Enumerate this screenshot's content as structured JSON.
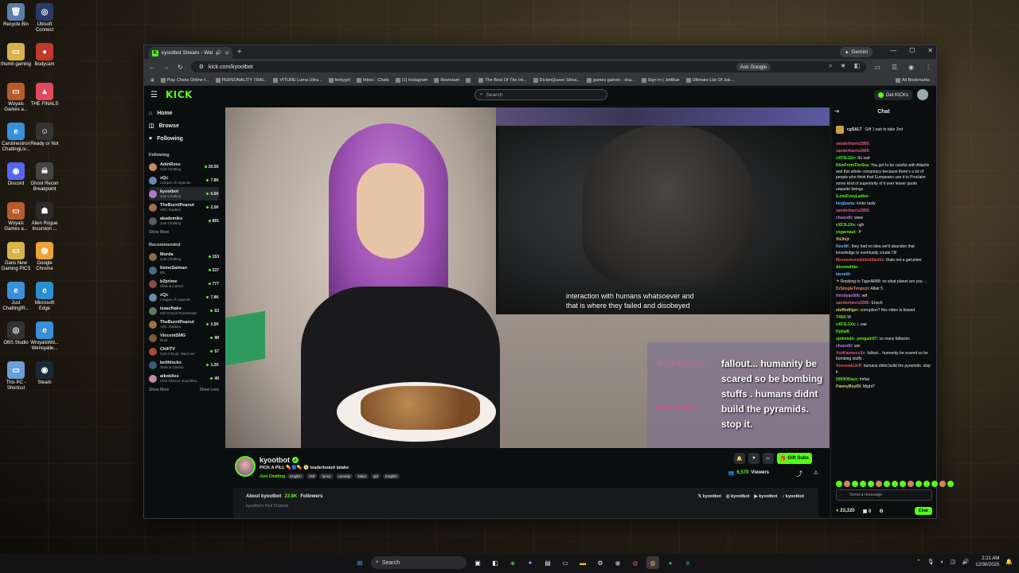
{
  "desktop": {
    "icons": [
      {
        "label": "Recycle Bin",
        "color": "#5b7fa8",
        "glyph": "🗑"
      },
      {
        "label": "Ubisoft Connect",
        "color": "#2a3a6a",
        "glyph": "◎"
      },
      {
        "label": "thumb gaming",
        "color": "#d9b34a",
        "glyph": "▭"
      },
      {
        "label": "Bodycam",
        "color": "#c0392b",
        "glyph": "●"
      },
      {
        "label": "Woyals Games a...",
        "color": "#b85a2a",
        "glyph": "▭"
      },
      {
        "label": "THE FINALS",
        "color": "#e04a60",
        "glyph": "▲"
      },
      {
        "label": "Carolinestron ChattingLiv...",
        "color": "#3a8fd9",
        "glyph": "e"
      },
      {
        "label": "Ready or Not",
        "color": "#333",
        "glyph": "☺"
      },
      {
        "label": "Discord",
        "color": "#5865f2",
        "glyph": "◉"
      },
      {
        "label": "Ghost Recon Breakpoint",
        "color": "#444",
        "glyph": "☠"
      },
      {
        "label": "Woyals Games a...",
        "color": "#b85a2a",
        "glyph": "▭"
      },
      {
        "label": "Alien Rogue Incursion ...",
        "color": "#2b2b2b",
        "glyph": "☗"
      },
      {
        "label": "Dans New Gaming PICS",
        "color": "#d9b34a",
        "glyph": "▭"
      },
      {
        "label": "Google Chrome",
        "color": "#e8a33a",
        "glyph": "◍"
      },
      {
        "label": "Just ChattingIR...",
        "color": "#3a8fd9",
        "glyph": "e"
      },
      {
        "label": "Microsoft Edge",
        "color": "#2a8fd0",
        "glyph": "e"
      },
      {
        "label": "OBS Studio",
        "color": "#333",
        "glyph": "◎"
      },
      {
        "label": "WroyalsWd... Wensyalie...",
        "color": "#3a8fd9",
        "glyph": "e"
      },
      {
        "label": "This PC - Shortcut",
        "color": "#6aa0d8",
        "glyph": "▭"
      },
      {
        "label": "Steam",
        "color": "#1b2838",
        "glyph": "◉"
      }
    ]
  },
  "browser": {
    "tab_title": "kyootbot Stream - Watch L",
    "gemini_label": "Gemini",
    "url": "kick.com/kyootbot",
    "ask_google": "Ask Google",
    "bookmarks": [
      "Play Chess Online f...",
      "PERSONALITY TRAI...",
      "VITURE Luma Ultra...",
      "fentygirl",
      "Inbox - Chats",
      "(1) Instagram",
      "Restream",
      "",
      "The Best Of The Int...",
      "DicienQueen Strea...",
      "games games - sha...",
      "Sign In | JetBlue",
      "Ultimate List Of Jok...",
      "All Bookmarks"
    ]
  },
  "kick": {
    "logo": "KICK",
    "search_placeholder": "Search",
    "get_kicks": "Get KICKs",
    "nav": {
      "home": "Home",
      "browse": "Browse",
      "following": "Following"
    },
    "following_title": "Following",
    "following": [
      {
        "name": "AdinRoss",
        "cat": "Just Chatting",
        "viewers": "29.5K",
        "color": "#c98a5a"
      },
      {
        "name": "xQc",
        "cat": "League of Legends",
        "viewers": "7.8K",
        "color": "#6a8ab0"
      },
      {
        "name": "kyootbot",
        "cat": "Just Chatting",
        "viewers": "6.6K",
        "color": "#b07ac0"
      },
      {
        "name": "TheBurntPeanut",
        "cat": "ARC Raiders",
        "viewers": "2.5K",
        "color": "#a0704a"
      },
      {
        "name": "akademiks",
        "cat": "Just Chatting",
        "viewers": "891",
        "color": "#5a5a5a"
      }
    ],
    "show_more": "Show More",
    "recommended_title": "Recommended",
    "recommended": [
      {
        "name": "Murda",
        "cat": "Just Chatting",
        "viewers": "153",
        "color": "#8a6a4a"
      },
      {
        "name": "ItsmeSalman",
        "cat": "IRL",
        "viewers": "237",
        "color": "#4a6a8a"
      },
      {
        "name": "b2prime",
        "cat": "Slots & Casino",
        "viewers": "777",
        "color": "#8a4a4a"
      },
      {
        "name": "xQc",
        "cat": "League of Legends",
        "viewers": "7.8K",
        "color": "#6a8ab0"
      },
      {
        "name": "IsaacNaks",
        "cat": "Old School RuneScape",
        "viewers": "63",
        "color": "#5a7a5a"
      },
      {
        "name": "TheBurntPeanut",
        "cat": "ARC Raiders",
        "viewers": "2.5K",
        "color": "#a0704a"
      },
      {
        "name": "VincentSMG",
        "cat": "Rust",
        "viewers": "98",
        "color": "#7a5a3a"
      },
      {
        "name": "ChiliTV",
        "cat": "Call of Duty: Warzone",
        "viewers": "57",
        "color": "#aa4a3a"
      },
      {
        "name": "keithlocks",
        "cat": "Slots & Casino",
        "viewers": "1.2K",
        "color": "#3a5a7a"
      },
      {
        "name": "aikobliss",
        "cat": "Clair Obscur: Expeditio...",
        "viewers": "48",
        "color": "#c08aa0"
      }
    ],
    "show_less": "Show Less",
    "video": {
      "subtitle_line1": "interaction with humans whatsoever and",
      "subtitle_line2": "that is where they failed and disobeyed",
      "overlay_user1": "XxxKaywexx:",
      "overlay_user2": "Annunaki...",
      "overlay_msg": "fallout... humanity be scared so be bombing stuffs . humans didnt build the pyramids. stop it."
    },
    "stream": {
      "name": "kyootbot",
      "title": "PICK A PILL 💊🔵💊 📀 leaderboard latake",
      "category": "Just Chatting",
      "tags": [
        "English",
        "chill",
        "funny",
        "comedy",
        "stake",
        "girl",
        "English"
      ],
      "gift_subs": "Gift Subs",
      "viewers": "6,570",
      "viewers_label": "Viewers",
      "about": "About kyootbot",
      "followers": "23.8K",
      "followers_label": "Followers",
      "about_sub": "kyootbot's Kick Channel",
      "socials": [
        "kyootbot",
        "kyootbot",
        "kyootbot",
        "kyootbot"
      ]
    },
    "chat": {
      "title": "Chat",
      "pinned_user": "cgSALT",
      "pinned_text": "Gift 1 sub to take 2nd",
      "messages": [
        {
          "user": "sanderharris2895:",
          "text": "",
          "color": "#e05a8a"
        },
        {
          "user": "sanderharris2895:",
          "text": "",
          "color": "#e05a8a"
        },
        {
          "user": "xXF3L1Xx:",
          "text": "So sad",
          "color": "#53fc18"
        },
        {
          "user": "RiseFromTheSea:",
          "text": "You got to be careful with Atlantis and this whole conspiracy because there's a lot of people who think that Europeans use it to Proclaim some kind of superiority of it over lesser quote unquote beings",
          "color": "#53fc18"
        },
        {
          "user": "iLoveFoxyLadies:",
          "text": "",
          "color": "#53fc18"
        },
        {
          "user": "kingkama:",
          "text": "looks tasty",
          "color": "#6ab0ff"
        },
        {
          "user": "sanderharris2895:",
          "text": "",
          "color": "#e05a8a"
        },
        {
          "user": "chazedit:",
          "text": "www",
          "color": "#c07ae0"
        },
        {
          "user": "xXF3L1Xx:",
          "text": "ugh",
          "color": "#53fc18"
        },
        {
          "user": "yogarnaut:",
          "text": ":P",
          "color": "#53fc18"
        },
        {
          "user": "XiiJinji:",
          "text": "",
          "color": "#e0d05a"
        },
        {
          "user": "NovAK:",
          "text": "they had no idea we'd abandon that knowledge to eventually create OF",
          "color": "#6ab0ff"
        },
        {
          "user": "Meeseeksnuklebuttlackle:",
          "text": "thats not a garuntee",
          "color": "#e05a5a"
        },
        {
          "user": "Atonewhite:",
          "text": "",
          "color": "#53fc18"
        },
        {
          "user": "lassetti:",
          "text": "",
          "color": "#6ab0ff"
        },
        {
          "user": "",
          "text": "↰ Replying to TigerAR88: so what planet are you ...",
          "color": "#888"
        },
        {
          "user": "DrSimpleTonpuzi:",
          "text": "Altair 5",
          "color": "#e08a5a"
        },
        {
          "user": "Hristiyan906:",
          "text": "wtf",
          "color": "#c07ae0"
        },
        {
          "user": "sanderharris2895:",
          "text": "Enoch",
          "color": "#e05a8a"
        },
        {
          "user": "stuffedtiger:",
          "text": "corruption? this video is biased",
          "color": "#e0d05a"
        },
        {
          "user": "T4NS",
          "text": "W",
          "color": "#53fc18"
        },
        {
          "user": "xXF3L1Xx:",
          "text": "L war",
          "color": "#53fc18"
        },
        {
          "user": "Kpkw8:",
          "text": "",
          "color": "#53fc18"
        },
        {
          "user": "optimistic_penguin07:",
          "text": "so many fallacies",
          "color": "#53fc18"
        },
        {
          "user": "chazedit:",
          "text": "ww",
          "color": "#c07ae0"
        },
        {
          "user": "XxxKaywexxXx:",
          "text": "fallout... humanity be scared so be bombing stuffs .",
          "color": "#e05a8a"
        },
        {
          "user": "AnnunakiJeff:",
          "text": "humans didnt build the pyramids. stop it.",
          "color": "#e05a5a"
        },
        {
          "user": "5000ODays:",
          "text": "lmfao",
          "color": "#53fc18"
        },
        {
          "user": "PawnyBoy69:",
          "text": "Might?",
          "color": "#e0d05a"
        }
      ],
      "send_placeholder": "Send a message",
      "kicks_count": "23,320",
      "other_count": "0",
      "chat_button": "Chat"
    }
  },
  "taskbar": {
    "search_label": "Search",
    "time": "2:21 AM",
    "date": "12/30/2025"
  }
}
